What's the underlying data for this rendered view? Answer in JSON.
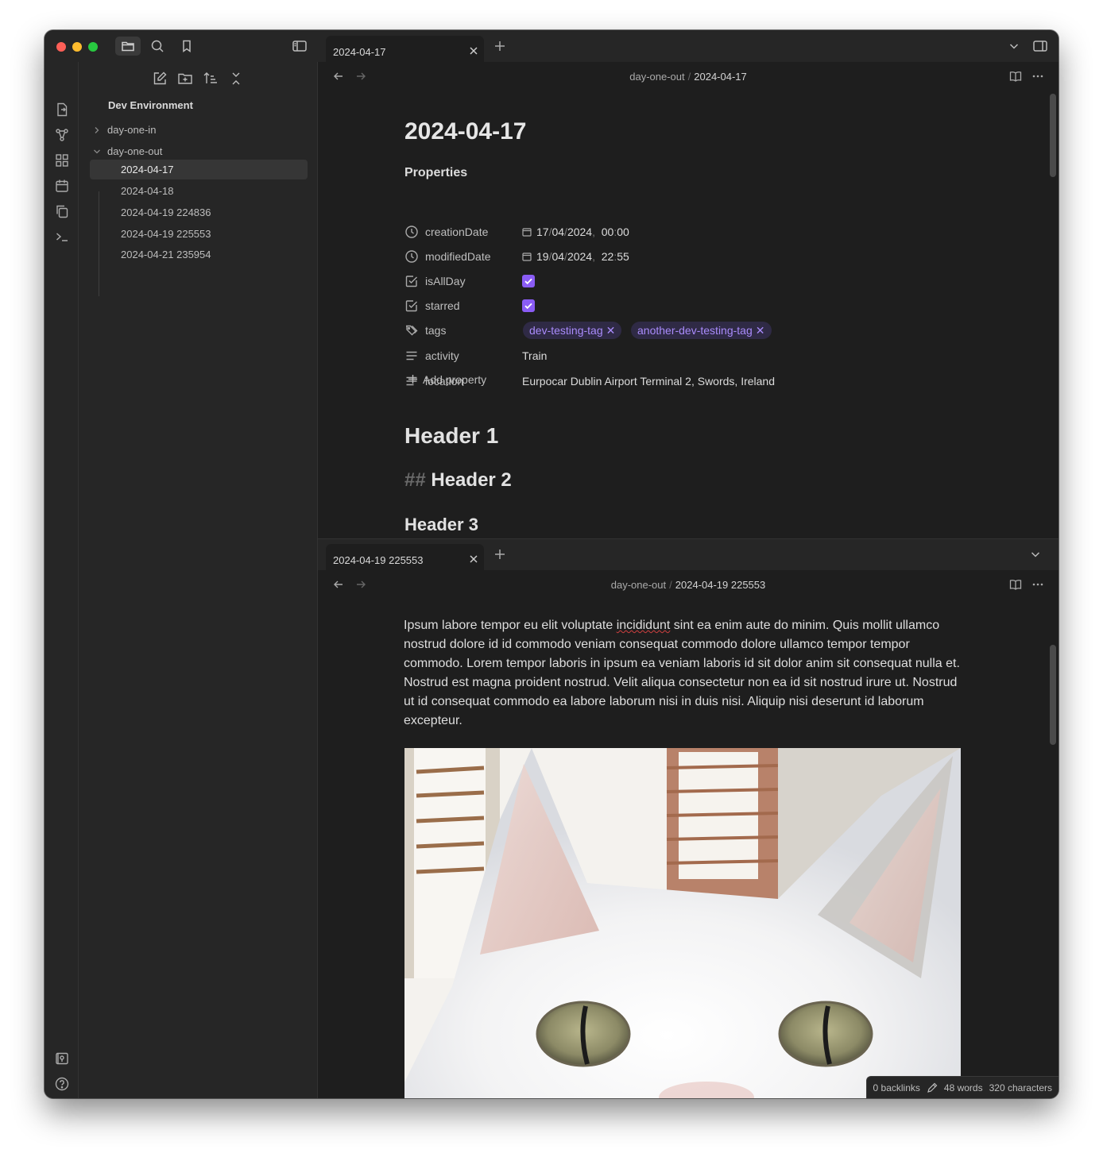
{
  "window": {
    "active_tab_top": "2024-04-17",
    "active_tab_bottom": "2024-04-19 225553"
  },
  "sidebar": {
    "vault_name": "Dev Environment",
    "tree": [
      {
        "label": "day-one-in",
        "level": 0,
        "expanded": false
      },
      {
        "label": "day-one-out",
        "level": 0,
        "expanded": true
      },
      {
        "label": "2024-04-17",
        "level": 1,
        "selected": true
      },
      {
        "label": "2024-04-18",
        "level": 1
      },
      {
        "label": "2024-04-19 224836",
        "level": 1
      },
      {
        "label": "2024-04-19 225553",
        "level": 1
      },
      {
        "label": "2024-04-21 235954",
        "level": 1
      }
    ]
  },
  "pane1": {
    "breadcrumb": {
      "folder": "day-one-out",
      "file": "2024-04-17"
    },
    "title": "2024-04-17",
    "properties_heading": "Properties",
    "properties": {
      "creationDate": {
        "name": "creationDate",
        "day": "17",
        "month": "04",
        "year": "2024",
        "hour": "00",
        "minute": "00"
      },
      "modifiedDate": {
        "name": "modifiedDate",
        "day": "19",
        "month": "04",
        "year": "2024",
        "hour": "22",
        "minute": "55"
      },
      "isAllDay": {
        "name": "isAllDay",
        "checked": true
      },
      "starred": {
        "name": "starred",
        "checked": true
      },
      "tags": {
        "name": "tags",
        "values": [
          "dev-testing-tag",
          "another-dev-testing-tag"
        ]
      },
      "activity": {
        "name": "activity",
        "value": "Train"
      },
      "location": {
        "name": "location",
        "value": "Eurpocar Dublin Airport Terminal 2, Swords, Ireland"
      }
    },
    "add_property": "Add property",
    "header1": "Header 1",
    "header2_marker": "##",
    "header2": "Header 2",
    "header3": "Header 3"
  },
  "pane2": {
    "breadcrumb": {
      "folder": "day-one-out",
      "file": "2024-04-19 225553"
    },
    "para_before": "Ipsum labore tempor eu elit voluptate ",
    "para_misspelled": "incididunt",
    "para_after": " sint ea enim aute do minim. Quis mollit ullamco nostrud dolore id id commodo veniam consequat commodo dolore ullamco tempor tempor commodo. Lorem tempor laboris in ipsum ea veniam laboris id sit dolor anim sit consequat nulla et. Nostrud est magna proident nostrud. Velit aliqua consectetur non ea id sit nostrud irure ut. Nostrud ut id consequat commodo ea labore laborum nisi in duis nisi. Aliquip nisi deserunt id laborum excepteur."
  },
  "statusbar": {
    "backlinks": "0 backlinks",
    "words": "48 words",
    "characters": "320 characters"
  },
  "colors": {
    "accent": "#8a5cf5",
    "tag_text": "#a98bfb",
    "tag_bg": "#2f2a45",
    "traffic_red": "#fe5f57",
    "traffic_yellow": "#febc2e",
    "traffic_green": "#28c840"
  }
}
